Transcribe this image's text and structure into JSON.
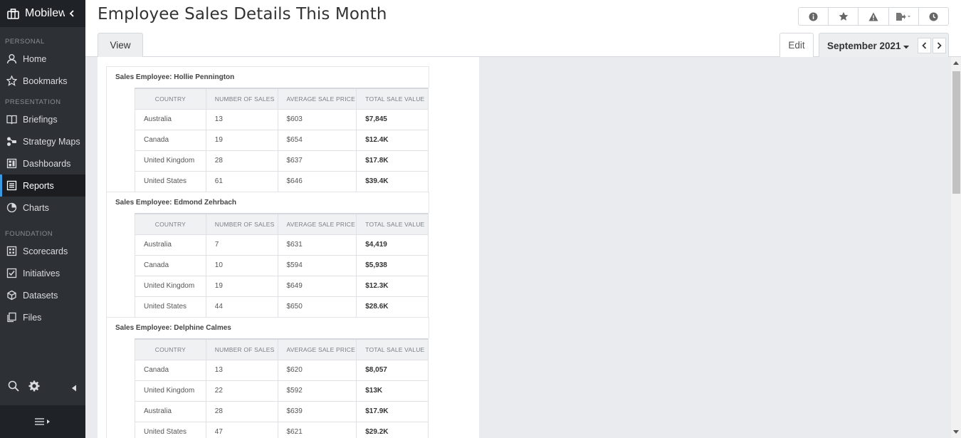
{
  "sidebar": {
    "brand": "Mobilew",
    "sections": [
      {
        "title": "PERSONAL",
        "items": [
          {
            "label": "Home",
            "icon": "user-icon"
          },
          {
            "label": "Bookmarks",
            "icon": "star-icon"
          }
        ]
      },
      {
        "title": "PRESENTATION",
        "items": [
          {
            "label": "Briefings",
            "icon": "book-icon"
          },
          {
            "label": "Strategy Maps",
            "icon": "strategy-map-icon"
          },
          {
            "label": "Dashboards",
            "icon": "dashboard-icon"
          },
          {
            "label": "Reports",
            "icon": "report-icon",
            "active": true
          },
          {
            "label": "Charts",
            "icon": "pie-chart-icon"
          }
        ]
      },
      {
        "title": "FOUNDATION",
        "items": [
          {
            "label": "Scorecards",
            "icon": "scorecard-icon"
          },
          {
            "label": "Initiatives",
            "icon": "checkbox-icon"
          },
          {
            "label": "Datasets",
            "icon": "cube-icon"
          },
          {
            "label": "Files",
            "icon": "files-icon"
          }
        ]
      }
    ]
  },
  "header": {
    "title": "Employee Sales Details This Month",
    "toolbar_icons": [
      "info-icon",
      "star-icon",
      "warning-icon",
      "export-icon",
      "clock-icon"
    ]
  },
  "tabs": {
    "view_label": "View",
    "edit_label": "Edit",
    "period_label": "September 2021"
  },
  "report": {
    "columns": [
      "COUNTRY",
      "NUMBER OF SALES",
      "AVERAGE SALE PRICE",
      "TOTAL SALE VALUE"
    ],
    "employees": [
      {
        "title": "Sales Employee: Hollie Pennington",
        "rows": [
          [
            "Australia",
            "13",
            "$603",
            "$7,845"
          ],
          [
            "Canada",
            "19",
            "$654",
            "$12.4K"
          ],
          [
            "United Kingdom",
            "28",
            "$637",
            "$17.8K"
          ],
          [
            "United States",
            "61",
            "$646",
            "$39.4K"
          ]
        ]
      },
      {
        "title": "Sales Employee: Edmond Zehrbach",
        "rows": [
          [
            "Australia",
            "7",
            "$631",
            "$4,419"
          ],
          [
            "Canada",
            "10",
            "$594",
            "$5,938"
          ],
          [
            "United Kingdom",
            "19",
            "$649",
            "$12.3K"
          ],
          [
            "United States",
            "44",
            "$650",
            "$28.6K"
          ]
        ]
      },
      {
        "title": "Sales Employee: Delphine Calmes",
        "rows": [
          [
            "Canada",
            "13",
            "$620",
            "$8,057"
          ],
          [
            "United Kingdom",
            "22",
            "$592",
            "$13K"
          ],
          [
            "Australia",
            "28",
            "$639",
            "$17.9K"
          ],
          [
            "United States",
            "47",
            "$621",
            "$29.2K"
          ]
        ]
      }
    ]
  },
  "colors": {
    "sidebar_bg": "#2d3035",
    "active_accent": "#3b9ae1",
    "content_bg": "#e9ebee"
  }
}
